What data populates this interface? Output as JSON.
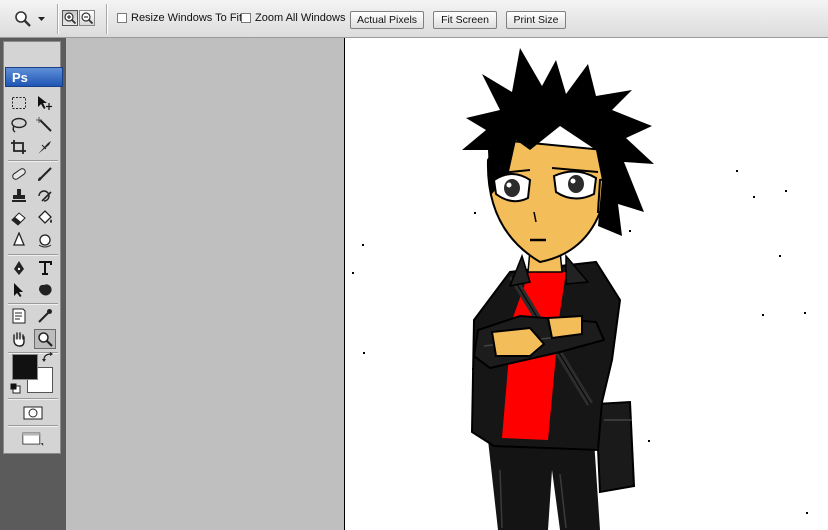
{
  "options_bar": {
    "tool_preset_icon": "zoom-magnifier-icon",
    "zoom_in_icon": "zoom-in-icon",
    "zoom_out_icon": "zoom-out-icon",
    "resize_windows_label": "Resize Windows To Fit",
    "resize_windows_checked": false,
    "zoom_all_label": "Zoom All Windows",
    "zoom_all_checked": false,
    "actual_pixels_label": "Actual Pixels",
    "fit_screen_label": "Fit Screen",
    "print_size_label": "Print Size"
  },
  "toolbox": {
    "collapse_glyph": "◂◂",
    "logo": "Ps",
    "tools": [
      "rectangular-marquee",
      "move",
      "lasso",
      "magic-wand",
      "crop",
      "slice",
      "healing-brush",
      "brush",
      "clone-stamp",
      "history-brush",
      "eraser",
      "paint-bucket",
      "blur",
      "dodge",
      "pen",
      "type",
      "path-selection",
      "custom-shape",
      "notes",
      "eyedropper",
      "hand",
      "zoom"
    ],
    "selected_tool": "zoom",
    "foreground_color": "#111111",
    "background_color": "#ffffff"
  },
  "colors": {
    "workspace": "#bfbfbf",
    "canvas": "#ffffff",
    "skin": "#f3bd5a",
    "shirt": "#ff0000",
    "jacket": "#141414"
  }
}
